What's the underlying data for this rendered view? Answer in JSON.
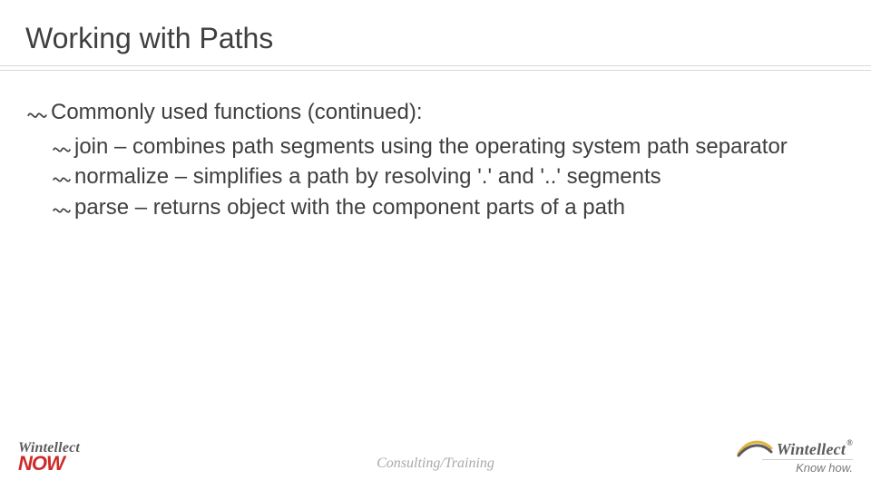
{
  "title": "Working with Paths",
  "content": {
    "heading": "Commonly used functions (continued):",
    "items": [
      "join – combines path segments using the operating system path separator",
      "normalize – simplifies a path by resolving '.' and '..' segments",
      "parse – returns object with the component parts of a path"
    ]
  },
  "footer": {
    "left_brand_top": "Wintellect",
    "left_brand_bottom": "NOW",
    "center": "Consulting/Training",
    "right_brand": "Wintellect",
    "right_tagline": "Know how."
  }
}
